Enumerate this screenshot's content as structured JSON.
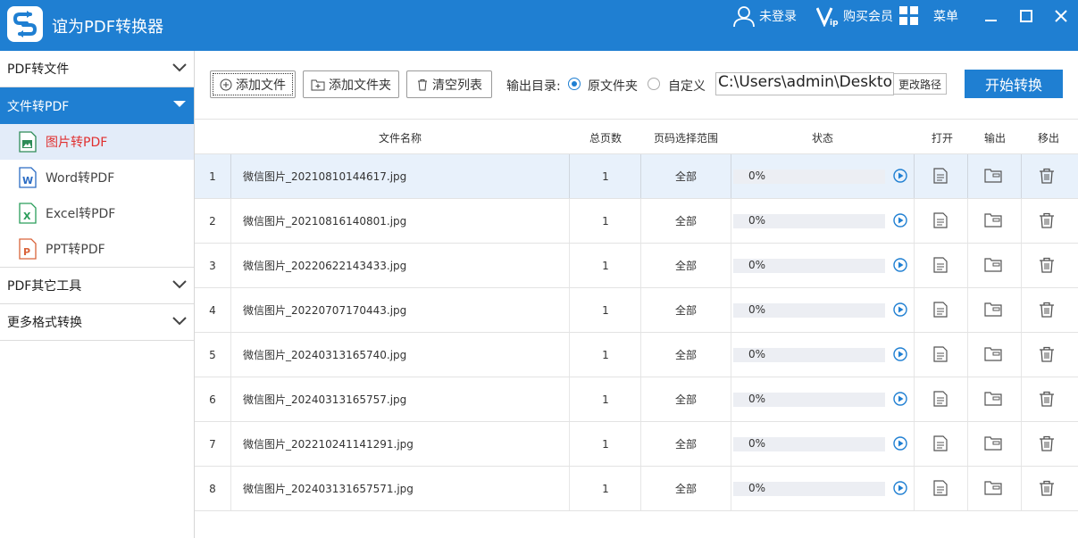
{
  "app": {
    "title": "谊为PDF转换器",
    "login_label": "未登录",
    "vip_label": "购买会员",
    "menu_label": "菜单",
    "accent": "#1f7fd2"
  },
  "sidebar": {
    "groups": [
      {
        "label": "PDF转文件"
      },
      {
        "label": "文件转PDF"
      },
      {
        "label": "PDF其它工具"
      },
      {
        "label": "更多格式转换"
      }
    ],
    "sub_items": [
      {
        "label": "图片转PDF",
        "icon": "image-file-icon"
      },
      {
        "label": "Word转PDF",
        "icon": "word-file-icon"
      },
      {
        "label": "Excel转PDF",
        "icon": "excel-file-icon"
      },
      {
        "label": "PPT转PDF",
        "icon": "ppt-file-icon"
      }
    ]
  },
  "toolbar": {
    "add_file": "添加文件",
    "add_folder": "添加文件夹",
    "clear_list": "清空列表",
    "output_label": "输出目录:",
    "opt_original": "原文件夹",
    "opt_custom": "自定义",
    "path_value": "C:\\Users\\admin\\Desktop",
    "change_path": "更改路径",
    "start": "开始转换"
  },
  "table": {
    "headers": {
      "name": "文件名称",
      "pages": "总页数",
      "range": "页码选择范围",
      "status": "状态",
      "open": "打开",
      "output": "输出",
      "remove": "移出"
    },
    "rows": [
      {
        "idx": "1",
        "name": "微信图片_20210810144617.jpg",
        "pages": "1",
        "range": "全部",
        "progress": "0%"
      },
      {
        "idx": "2",
        "name": "微信图片_20210816140801.jpg",
        "pages": "1",
        "range": "全部",
        "progress": "0%"
      },
      {
        "idx": "3",
        "name": "微信图片_20220622143433.jpg",
        "pages": "1",
        "range": "全部",
        "progress": "0%"
      },
      {
        "idx": "4",
        "name": "微信图片_20220707170443.jpg",
        "pages": "1",
        "range": "全部",
        "progress": "0%"
      },
      {
        "idx": "5",
        "name": "微信图片_20240313165740.jpg",
        "pages": "1",
        "range": "全部",
        "progress": "0%"
      },
      {
        "idx": "6",
        "name": "微信图片_20240313165757.jpg",
        "pages": "1",
        "range": "全部",
        "progress": "0%"
      },
      {
        "idx": "7",
        "name": "微信图片_202210241141291.jpg",
        "pages": "1",
        "range": "全部",
        "progress": "0%"
      },
      {
        "idx": "8",
        "name": "微信图片_202403131657571.jpg",
        "pages": "1",
        "range": "全部",
        "progress": "0%"
      }
    ]
  }
}
